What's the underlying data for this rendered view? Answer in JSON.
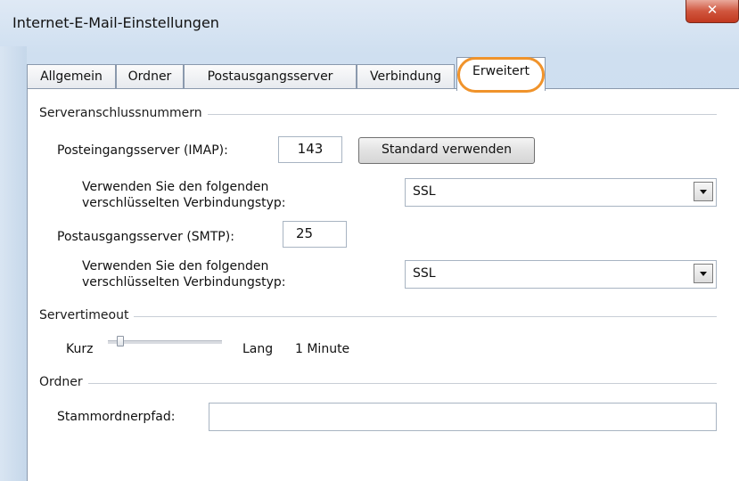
{
  "window": {
    "title": "Internet-E-Mail-Einstellungen",
    "close_glyph": "✕"
  },
  "tabs": [
    {
      "label": "Allgemein",
      "active": false
    },
    {
      "label": "Ordner",
      "active": false
    },
    {
      "label": "Postausgangsserver",
      "active": false
    },
    {
      "label": "Verbindung",
      "active": false
    },
    {
      "label": "Erweitert",
      "active": true
    }
  ],
  "server_ports": {
    "group_label": "Serveranschlussnummern",
    "incoming_label": "Posteingangsserver (IMAP):",
    "incoming_value": "143",
    "default_button": "Standard verwenden",
    "incoming_encryption_label_line1": "Verwenden Sie den folgenden",
    "incoming_encryption_label_line2": "verschlüsselten Verbindungstyp:",
    "incoming_encryption_value": "SSL",
    "outgoing_label": "Postausgangsserver (SMTP):",
    "outgoing_value": "25",
    "outgoing_encryption_label_line1": "Verwenden Sie den folgenden",
    "outgoing_encryption_label_line2": "verschlüsselten Verbindungstyp:",
    "outgoing_encryption_value": "SSL"
  },
  "timeout": {
    "group_label": "Servertimeout",
    "short_label": "Kurz",
    "long_label": "Lang",
    "value_text": "1 Minute",
    "level_fraction": 0.08
  },
  "folders": {
    "group_label": "Ordner",
    "root_path_label": "Stammordnerpfad:",
    "root_path_value": ""
  },
  "colors": {
    "highlight": "#f0932b",
    "close_button": "#c1391f"
  },
  "icons": {
    "close": "close-icon",
    "dropdown": "chevron-down-icon"
  }
}
